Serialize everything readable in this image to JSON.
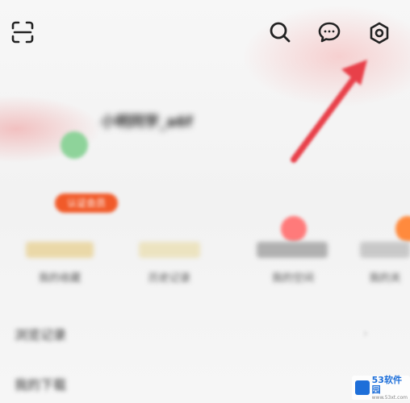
{
  "header": {
    "icons": [
      "scan-icon",
      "search-icon",
      "message-icon",
      "settings-icon"
    ]
  },
  "profile": {
    "username": "小明同学_a6f",
    "level_badge": "认证会员",
    "avatar_color": "#8ed39a"
  },
  "shortcuts": [
    {
      "label": "我的收藏"
    },
    {
      "label": "历史记录"
    },
    {
      "label": "我的空间"
    },
    {
      "label": "我的关"
    }
  ],
  "menu": [
    {
      "label": "浏览记录"
    },
    {
      "label": "我的下载"
    }
  ],
  "watermark": {
    "text": "53软件园",
    "sub": "www.53xt.com"
  },
  "colors": {
    "arrow": "#e8404a",
    "badge": "#f15a29",
    "icon": "#222222"
  }
}
